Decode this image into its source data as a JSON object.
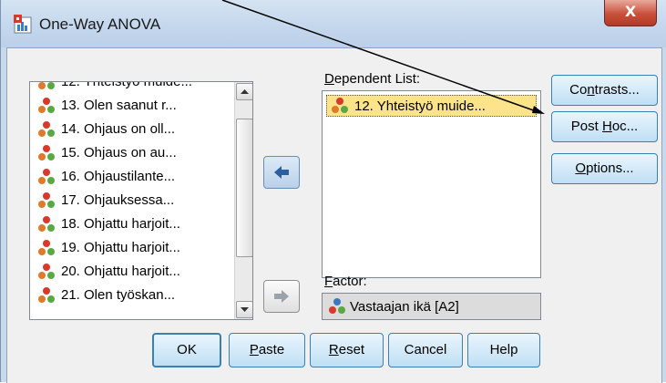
{
  "window": {
    "title": "One-Way ANOVA",
    "close_label": "X",
    "accent_color": "#3c7fb1"
  },
  "variable_list": {
    "items": [
      {
        "label": "12. Yhteistyö muide...",
        "partial": true
      },
      {
        "label": "13. Olen saanut r..."
      },
      {
        "label": "14. Ohjaus on oll..."
      },
      {
        "label": "15. Ohjaus on au..."
      },
      {
        "label": "16. Ohjaustilante..."
      },
      {
        "label": "17. Ohjauksessa..."
      },
      {
        "label": "18. Ohjattu harjoit..."
      },
      {
        "label": "19. Ohjattu harjoit..."
      },
      {
        "label": "20. Ohjattu harjoit..."
      },
      {
        "label": "21. Olen työskan...",
        "partial": true
      }
    ]
  },
  "dependent_list": {
    "label_pre": "",
    "label_u": "D",
    "label_post": "ependent List:",
    "items": [
      {
        "label": "12. Yhteistyö muide..."
      }
    ]
  },
  "factor": {
    "label_pre": "",
    "label_u": "F",
    "label_post": "actor:",
    "value": "Vastaajan ikä [A2]"
  },
  "side_buttons": {
    "contrasts": {
      "pre": "Co",
      "u": "n",
      "post": "trasts..."
    },
    "post_hoc": {
      "pre": "Post ",
      "u": "H",
      "post": "oc..."
    },
    "options": {
      "pre": "",
      "u": "O",
      "post": "ptions..."
    }
  },
  "bottom_buttons": {
    "ok": {
      "pre": "OK",
      "u": "",
      "post": ""
    },
    "paste": {
      "pre": "",
      "u": "P",
      "post": "aste"
    },
    "reset": {
      "pre": "",
      "u": "R",
      "post": "eset"
    },
    "cancel": {
      "pre": "Cancel",
      "u": "",
      "post": ""
    },
    "help": {
      "pre": "Help",
      "u": "",
      "post": ""
    }
  },
  "icons": {
    "variable": "scale-variable-icon",
    "move_right": "arrow-right-icon",
    "move_left": "arrow-left-icon"
  }
}
